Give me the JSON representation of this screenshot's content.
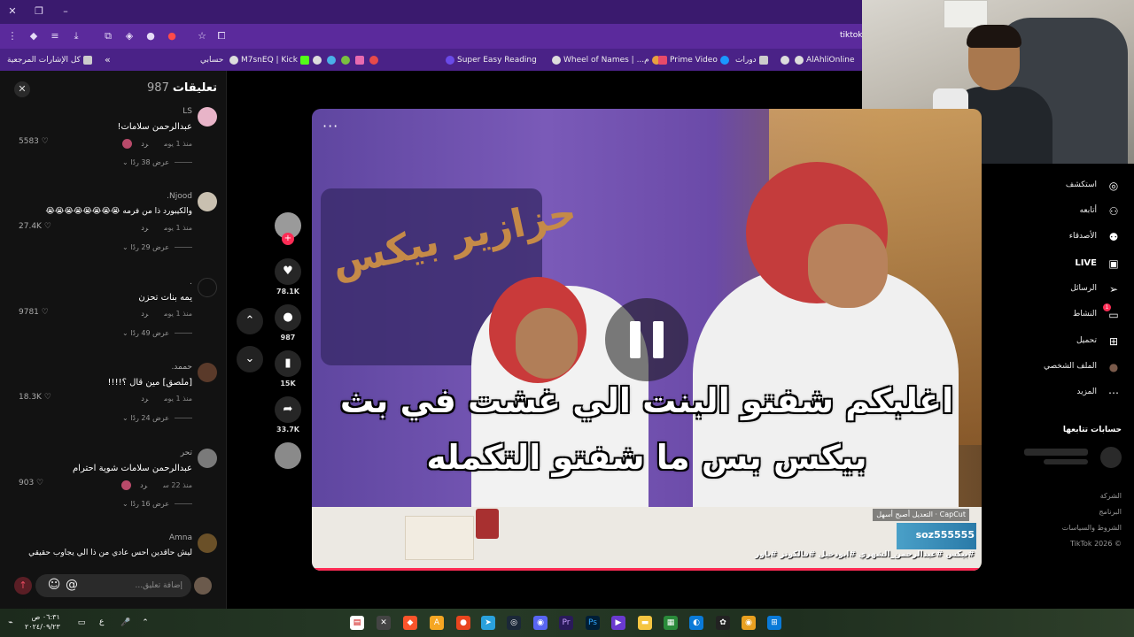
{
  "browser": {
    "tab_text": "tiktok",
    "bookmarks": [
      {
        "label": "كل الإشارات المرجعية"
      },
      {
        "label": "حسابي"
      },
      {
        "label": "M7snEQ | Kick"
      },
      {
        "label": "Super Easy Reading"
      },
      {
        "label": "Wheel of Names | ...م"
      },
      {
        "label": "Prime Video"
      },
      {
        "label": "دورات"
      },
      {
        "label": "AlAhliOnline"
      }
    ]
  },
  "comments": {
    "title": "تعليقات",
    "count": "987",
    "items": [
      {
        "user": "LS",
        "text": "عبدالرحمن سلامات!",
        "time": "منذ 1 يوم",
        "reply": "رد",
        "likes": "5583",
        "views": "عرض 38 ردًا",
        "avatar_color": "#e8b4c8"
      },
      {
        "user": "Njood.",
        "text": "والكيبورد ذا من فرمه 😭😭😭😭😭😭😭😭",
        "time": "منذ 1 يوم",
        "reply": "رد",
        "likes": "27.4K",
        "views": "عرض 29 ردًا",
        "avatar_color": "#c9c0b0"
      },
      {
        "user": ".",
        "text": "يمه بنات تحزن",
        "time": "منذ 1 يوم",
        "reply": "رد",
        "likes": "9781",
        "views": "عرض 49 ردًا",
        "avatar_color": "#111111"
      },
      {
        "user": "حممد.",
        "text": "[ملصق] مين قال ؟!!!!",
        "time": "منذ 1 يوم",
        "reply": "رد",
        "likes": "18.3K",
        "views": "عرض 24 ردًا",
        "avatar_color": "#5a3a2a"
      },
      {
        "user": "تحر",
        "text": "عبدالرحمن سلامات شوية احترام",
        "time": "منذ 22 س",
        "reply": "رد",
        "likes": "903",
        "views": "عرض 16 ردًا",
        "avatar_color": "#7a7a7a"
      },
      {
        "user": "Amna",
        "text": "ليش حاقدين احس عادي من ذا الي يجاوب حقيقي",
        "avatar_color": "#6a5028"
      }
    ],
    "input_placeholder": "إضافة تعليق..."
  },
  "actions": {
    "likes": "78.1K",
    "comments": "987",
    "saves": "15K",
    "shares": "33.7K"
  },
  "video": {
    "caption_line1": "اغلبكم شفتو البنت الي غشت في بث",
    "caption_line2": "بيكس بس ما شفتو التكمله",
    "sign_text": "حزازير بيكس",
    "capcut": "CapCut · التعديل أصبح أسهل",
    "handle": "soz555555",
    "tags": "#بيكس #عبدالرحمن_الشهري #ابودخيل #فالكونز #باور"
  },
  "sidebar": {
    "nav": [
      {
        "label": "استكشف",
        "icon": "compass-icon",
        "glyph": "◎"
      },
      {
        "label": "أتابعه",
        "icon": "following-icon",
        "glyph": "⚇"
      },
      {
        "label": "الأصدقاء",
        "icon": "friends-icon",
        "glyph": "⚉"
      },
      {
        "label": "LIVE",
        "icon": "live-icon",
        "glyph": "▣"
      },
      {
        "label": "الرسائل",
        "icon": "messages-icon",
        "glyph": "➢"
      },
      {
        "label": "النشاط",
        "icon": "activity-icon",
        "glyph": "▭"
      },
      {
        "label": "تحميل",
        "icon": "upload-icon",
        "glyph": "⊞"
      },
      {
        "label": "الملف الشخصي",
        "icon": "profile-icon",
        "glyph": "●"
      },
      {
        "label": "المزيد",
        "icon": "more-icon",
        "glyph": "⋯"
      }
    ],
    "activity_badge": "1",
    "following_title": "حسابات تتابعها",
    "footer": [
      "الشركة",
      "البرنامج",
      "الشروط والسياسات",
      "© 2026 TikTok"
    ]
  },
  "taskbar": {
    "time": "٠٦:٣١ ص",
    "date": "٢٠٢٤/٠٩/٢٣",
    "lang": "ع"
  },
  "colors": {
    "accent": "#fe2c55",
    "browser_purple": "#5b2a9c"
  }
}
